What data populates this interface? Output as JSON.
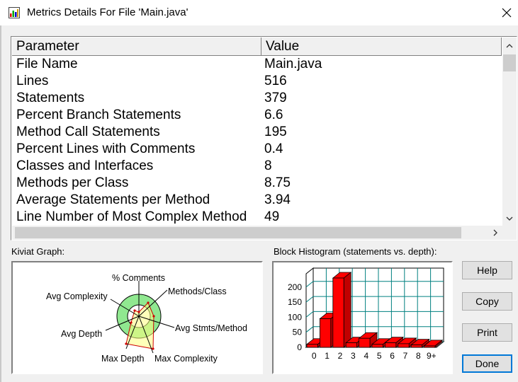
{
  "window": {
    "title": "Metrics Details For File 'Main.java'"
  },
  "table": {
    "headers": [
      "Parameter",
      "Value"
    ],
    "rows": [
      {
        "param": "File Name",
        "value": "Main.java"
      },
      {
        "param": "Lines",
        "value": "516"
      },
      {
        "param": "Statements",
        "value": "379"
      },
      {
        "param": "Percent Branch Statements",
        "value": "6.6"
      },
      {
        "param": "Method Call Statements",
        "value": "195"
      },
      {
        "param": "Percent Lines with Comments",
        "value": "0.4"
      },
      {
        "param": "Classes and Interfaces",
        "value": "8"
      },
      {
        "param": "Methods per Class",
        "value": "8.75"
      },
      {
        "param": "Average Statements per Method",
        "value": "3.94"
      },
      {
        "param": "Line Number of Most Complex Method",
        "value": "49"
      }
    ]
  },
  "kiviat": {
    "label": "Kiviat Graph:",
    "axes": [
      "% Comments",
      "Methods/Class",
      "Avg Stmts/Method",
      "Max Complexity",
      "Max Depth",
      "Avg Depth",
      "Avg Complexity"
    ]
  },
  "histogram": {
    "label": "Block Histogram (statements vs. depth):",
    "chart_data": {
      "type": "bar",
      "categories": [
        "0",
        "1",
        "2",
        "3",
        "4",
        "5",
        "6",
        "7",
        "8",
        "9+"
      ],
      "values": [
        10,
        95,
        230,
        15,
        30,
        10,
        15,
        12,
        8,
        5
      ],
      "ylim": [
        0,
        230
      ],
      "yticks": [
        "0",
        "50",
        "100",
        "150",
        "200"
      ],
      "grid": true,
      "bar_color": "#ff0000",
      "grid_color": "#008080"
    }
  },
  "buttons": {
    "help": "Help",
    "copy": "Copy",
    "print": "Print",
    "done": "Done"
  }
}
